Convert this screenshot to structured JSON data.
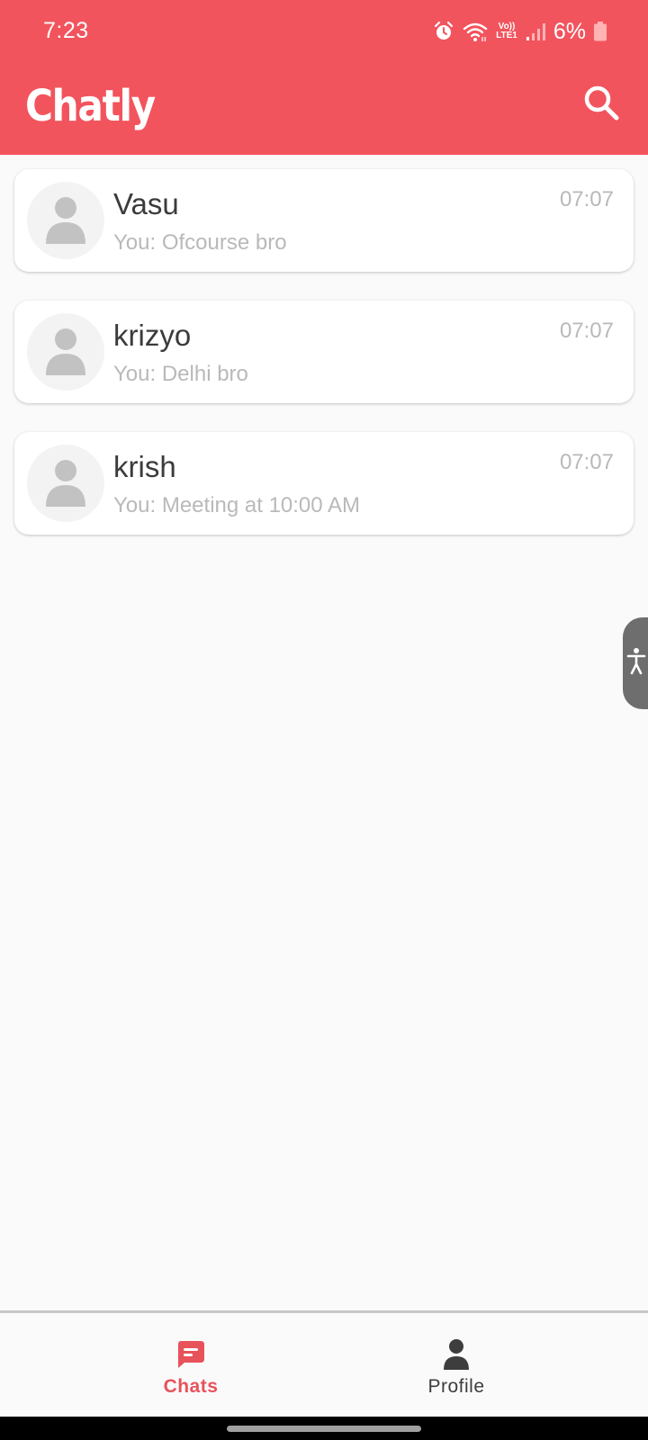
{
  "status_bar": {
    "time": "7:23",
    "network_line1": "Vo))",
    "network_line2": "LTE1",
    "battery": "6%",
    "icons": [
      "alarm-icon",
      "wifi-icon",
      "signal-icon",
      "battery-icon"
    ]
  },
  "app_bar": {
    "title": "Chatly",
    "search_icon": "search-icon",
    "background_color": "#f2545d"
  },
  "chats": [
    {
      "name": "Vasu",
      "preview": "You: Ofcourse bro",
      "time": "07:07"
    },
    {
      "name": "krizyo",
      "preview": "You: Delhi bro",
      "time": "07:07"
    },
    {
      "name": "krish",
      "preview": "You: Meeting at 10:00 AM",
      "time": "07:07"
    }
  ],
  "bottom_nav": {
    "items": [
      {
        "label": "Chats",
        "icon": "chat-bubble-icon",
        "active": true
      },
      {
        "label": "Profile",
        "icon": "person-icon",
        "active": false
      }
    ],
    "active_color": "#e8525b"
  },
  "accessibility_button": {
    "icon": "accessibility-icon"
  }
}
